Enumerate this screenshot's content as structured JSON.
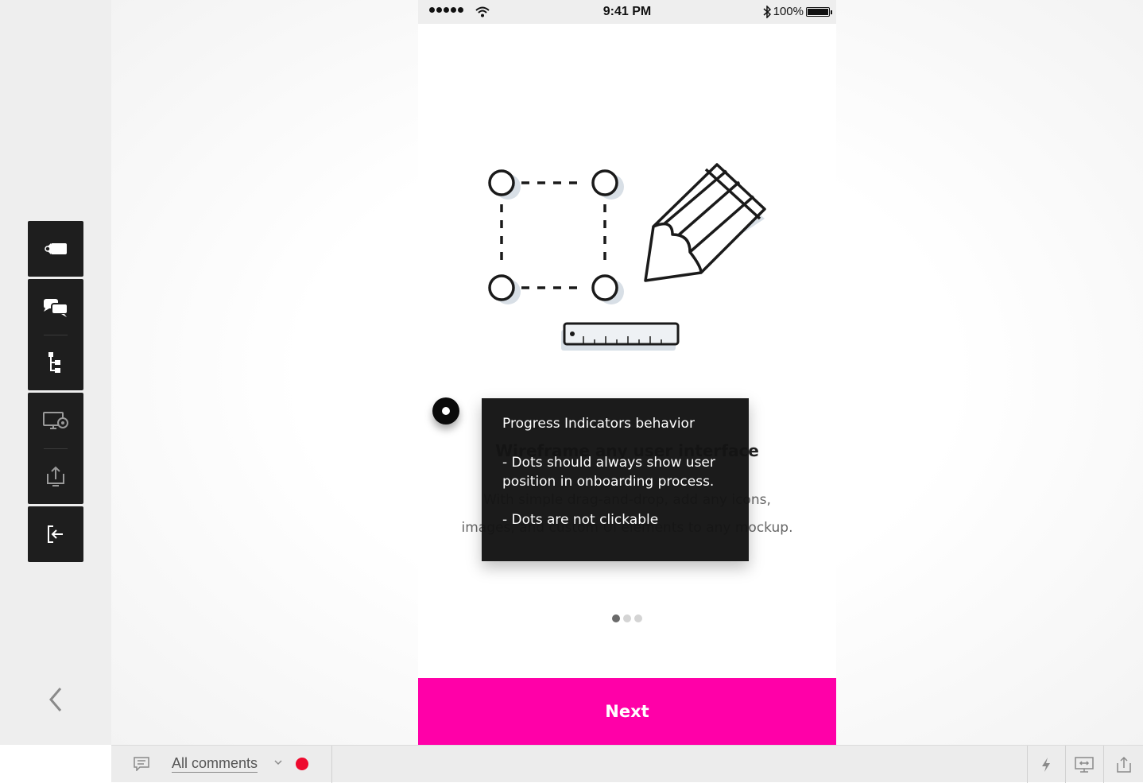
{
  "statusbar": {
    "time": "9:41 PM",
    "battery": "100%"
  },
  "toolbar": {
    "icons": [
      "tag-icon",
      "comments-icon",
      "sitemap-icon",
      "preview-devices-icon",
      "export-icon",
      "exit-icon"
    ],
    "collapse_icon": "chevron-left-icon"
  },
  "screen": {
    "headline": "Wireframe any user interface",
    "body_line1": "With simple drag-and-drop, add any icons,",
    "body_line2": "images, and custom UI elements to any mockup.",
    "progress": {
      "total": 3,
      "active_index": 0
    },
    "next_label": "Next",
    "accent_color": "#ff00a8"
  },
  "comment": {
    "title": "Progress Indicators behavior",
    "point1_line1": "- Dots should always show user",
    "point1_line2": "position in onboarding process.",
    "point2": "- Dots are not clickable"
  },
  "bottom_bar": {
    "filter_label": "All comments",
    "record_color": "#ee0a2e",
    "right_icons": [
      "lightning-icon",
      "present-icon",
      "share-icon"
    ]
  }
}
